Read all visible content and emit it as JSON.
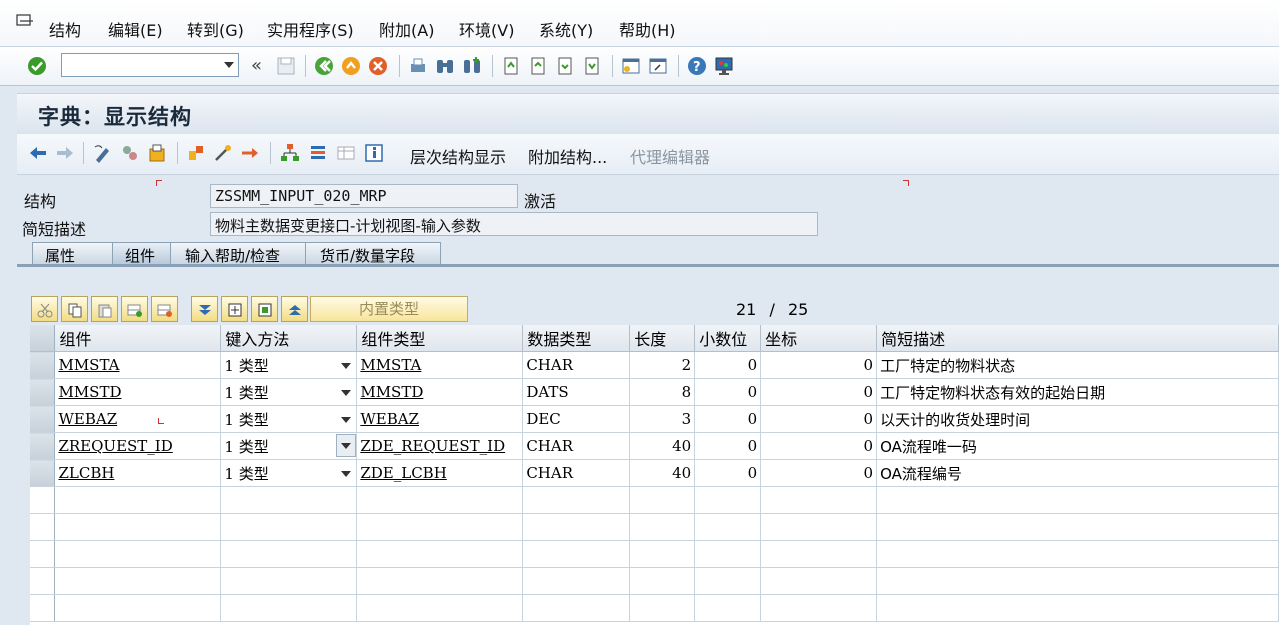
{
  "menu": [
    "结构",
    "编辑(E)",
    "转到(G)",
    "实用程序(S)",
    "附加(A)",
    "环境(V)",
    "系统(Y)",
    "帮助(H)"
  ],
  "title": "字典：显示结构",
  "app_toolbar": {
    "hierarchy": "层次结构显示",
    "append": "附加结构...",
    "proxy": "代理编辑器"
  },
  "form": {
    "structure_label": "结构",
    "structure_value": "ZSSMM_INPUT_020_MRP",
    "status": "激活",
    "desc_label": "简短描述",
    "desc_value": "物料主数据变更接口-计划视图-输入参数"
  },
  "tabs": [
    "属性",
    "组件",
    "输入帮助/检查",
    "货币/数量字段"
  ],
  "table_toolbar": {
    "builtin_type": "内置类型",
    "counter_current": "21",
    "counter_sep": "/",
    "counter_total": "25"
  },
  "columns": [
    "组件",
    "键入方法",
    "组件类型",
    "数据类型",
    "长度",
    "小数位",
    "坐标",
    "简短描述"
  ],
  "rows": [
    {
      "component": "MMSTA",
      "method": "1 类型",
      "ctype": "MMSTA",
      "dtype": "CHAR",
      "length": "2",
      "decimals": "0",
      "coord": "0",
      "desc": "工厂特定的物料状态"
    },
    {
      "component": "MMSTD",
      "method": "1 类型",
      "ctype": "MMSTD",
      "dtype": "DATS",
      "length": "8",
      "decimals": "0",
      "coord": "0",
      "desc": "工厂特定物料状态有效的起始日期"
    },
    {
      "component": "WEBAZ",
      "method": "1 类型",
      "ctype": "WEBAZ",
      "dtype": "DEC",
      "length": "3",
      "decimals": "0",
      "coord": "0",
      "desc": "以天计的收货处理时间"
    },
    {
      "component": "ZREQUEST_ID",
      "method": "1 类型",
      "ctype": "ZDE_REQUEST_ID",
      "dtype": "CHAR",
      "length": "40",
      "decimals": "0",
      "coord": "0",
      "desc": "OA流程唯一码"
    },
    {
      "component": "ZLCBH",
      "method": "1 类型",
      "ctype": "ZDE_LCBH",
      "dtype": "CHAR",
      "length": "40",
      "decimals": "0",
      "coord": "0",
      "desc": "OA流程编号"
    }
  ],
  "colors": {
    "accent_green": "#3a9b2c",
    "header_bg": "#dfe6ed",
    "selected_tab": "#b9cadb"
  }
}
